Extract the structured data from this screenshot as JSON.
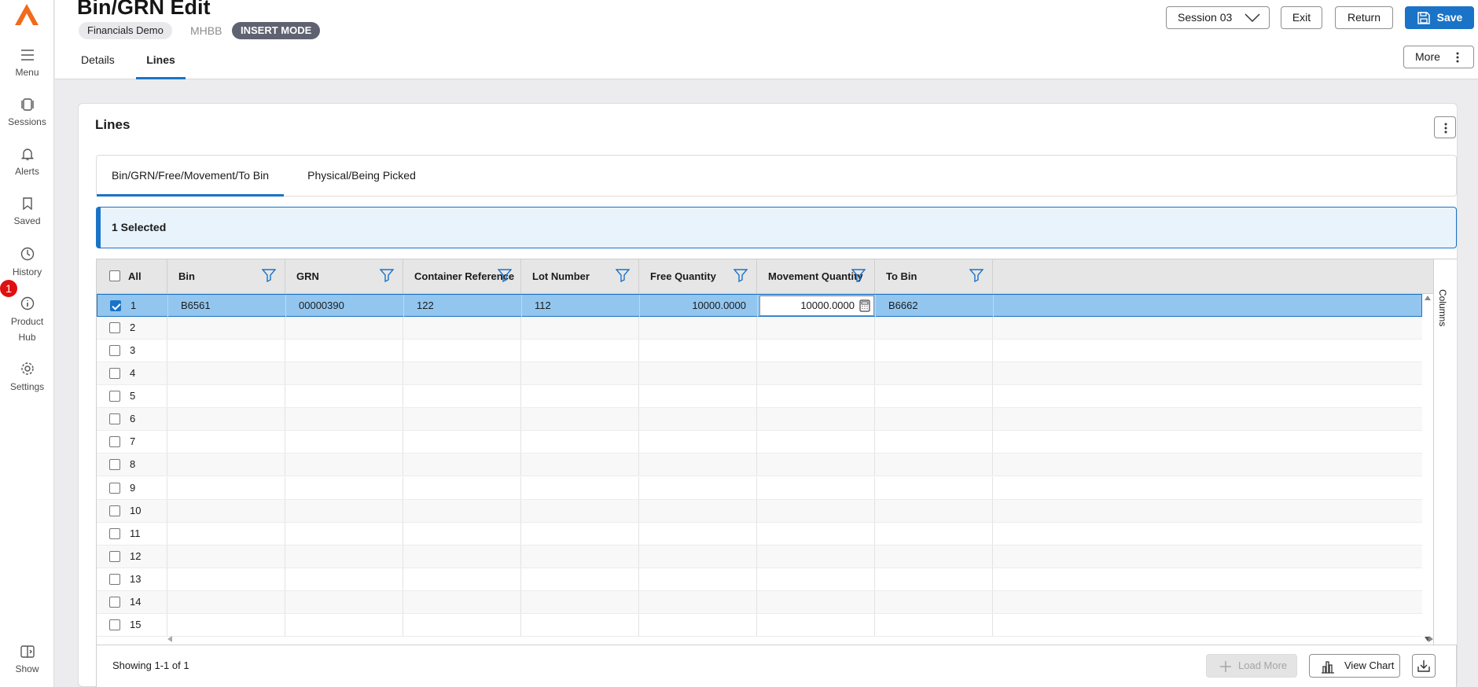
{
  "rail": {
    "items": [
      {
        "label": "Menu",
        "icon": "hamburger-icon"
      },
      {
        "label": "Sessions",
        "icon": "sessions-icon"
      },
      {
        "label": "Alerts",
        "icon": "bell-icon"
      },
      {
        "label": "Saved",
        "icon": "bookmark-icon"
      },
      {
        "label": "History",
        "icon": "clock-icon"
      },
      {
        "label": "Product",
        "icon": "info-icon"
      },
      {
        "label": "Settings",
        "icon": "gear-icon"
      },
      {
        "label": "Show",
        "icon": "panel-toggle-icon"
      }
    ],
    "product_hub_second_line": "Hub",
    "product_badge": "1"
  },
  "header": {
    "title": "Bin/GRN Edit",
    "company": "Financials Demo",
    "code": "MHBB",
    "mode": "INSERT MODE",
    "tabs": [
      "Details",
      "Lines"
    ],
    "active_tab": "Lines",
    "session": "Session 03",
    "exit_label": "Exit",
    "return_label": "Return",
    "save_label": "Save",
    "more_label": "More"
  },
  "card": {
    "title": "Lines",
    "subtabs": [
      "Bin/GRN/Free/Movement/To Bin",
      "Physical/Being Picked"
    ],
    "selected_text": "1 Selected"
  },
  "grid": {
    "all_label": "All",
    "columns": [
      "Bin",
      "GRN",
      "Container Reference",
      "Lot Number",
      "Free Quantity",
      "Movement Quantity",
      "To Bin"
    ],
    "rows": [
      {
        "num": "1",
        "bin": "B6561",
        "grn": "00000390",
        "container": "122",
        "lot": "112",
        "free": "10000.0000",
        "movement": "10000.0000",
        "to_bin": "B6662"
      },
      {
        "num": "2"
      },
      {
        "num": "3"
      },
      {
        "num": "4"
      },
      {
        "num": "5"
      },
      {
        "num": "6"
      },
      {
        "num": "7"
      },
      {
        "num": "8"
      },
      {
        "num": "9"
      },
      {
        "num": "10"
      },
      {
        "num": "11"
      },
      {
        "num": "12"
      },
      {
        "num": "13"
      },
      {
        "num": "14"
      },
      {
        "num": "15"
      }
    ],
    "selected_rows": [
      1
    ],
    "columns_side_label": "Columns",
    "showing": "Showing 1-1 of 1",
    "load_more_label": "Load More",
    "view_chart_label": "View Chart"
  },
  "colors": {
    "accent": "#1a73c7",
    "selected_row": "#92c6ef",
    "logo": "#f26a1b",
    "badge": "#e01010"
  }
}
